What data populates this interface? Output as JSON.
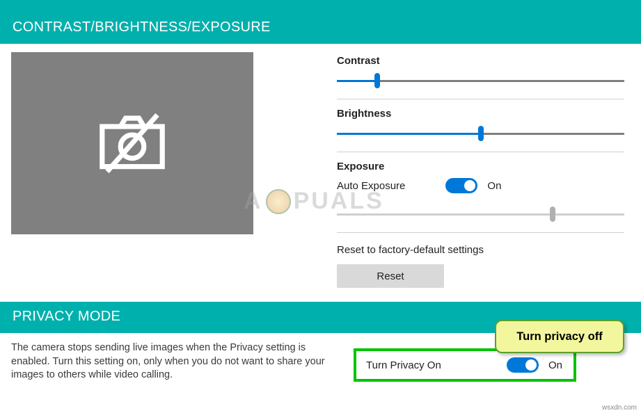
{
  "sections": {
    "contrast_header": "CONTRAST/BRIGHTNESS/EXPOSURE",
    "privacy_header": "PRIVACY MODE"
  },
  "controls": {
    "contrast": {
      "label": "Contrast",
      "value_pct": 14
    },
    "brightness": {
      "label": "Brightness",
      "value_pct": 50
    },
    "exposure": {
      "label": "Exposure",
      "auto_label": "Auto Exposure",
      "toggle_state": "On",
      "slider_pct": 75
    },
    "reset": {
      "text": "Reset to factory-default settings",
      "button": "Reset"
    }
  },
  "privacy": {
    "description": "The camera stops sending live images when the Privacy setting is enabled. Turn this setting on, only when you do not want to share your images to others while video calling.",
    "toggle_label": "Turn Privacy On",
    "toggle_state": "On"
  },
  "callout": "Turn privacy off",
  "watermark": "A  PUALS",
  "credit": "wsxdn.com"
}
